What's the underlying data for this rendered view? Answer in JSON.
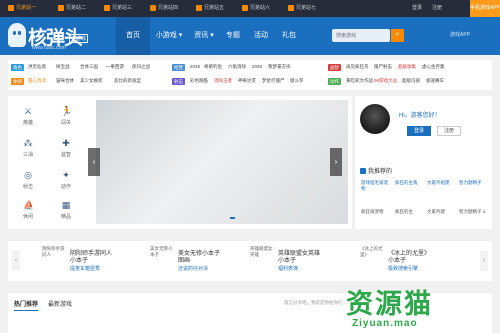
{
  "topbar": {
    "tabs": [
      "兄弟站一",
      "兄弟站二",
      "兄弟站三",
      "兄弟站四",
      "兄弟站五",
      "兄弟站六",
      "兄弟站七"
    ],
    "login": "登录",
    "register": "注册",
    "app": "手机游戏APP"
  },
  "logo": {
    "title": "核弹头",
    "tag": "小游戏",
    "url": "www.h5uc.com"
  },
  "nav": {
    "items": [
      "首页",
      "小游戏 ▾",
      "资讯 ▾",
      "专题",
      "活动",
      "礼包"
    ],
    "search_placeholder": "搜索游戏",
    "mobile": "游戏APP"
  },
  "categories": {
    "row1": [
      {
        "badge": "角色",
        "color": "#2b9bd8",
        "items": [
          "洪荒仙境",
          "探宝战",
          "合体三国",
          "一拳西游",
          "侠归之战"
        ]
      },
      {
        "badge": "经营",
        "color": "#4a8fd6",
        "items": [
          "2048",
          "奇葩钓鱼",
          "六角消除",
          "2048",
          "我梦豪方块"
        ]
      },
      {
        "badge": "益智",
        "color": "#d53c3c",
        "items": [
          "再见疯狂鸟",
          "僵尸射击",
          "超级收集",
          "虚心生存集"
        ]
      }
    ],
    "row2": [
      {
        "badge": "休闲",
        "color": "#f08a1a",
        "items": [
          "甜心消消",
          "猫咪合体",
          "美少女换装",
          "恶比的新发型"
        ]
      },
      {
        "badge": "射击",
        "color": "#6a5acd",
        "items": [
          "彩色跑酷",
          "消除王者",
          "神奇达芙",
          "梦星打僵尸",
          "傲斗罗"
        ]
      },
      {
        "badge": "动作",
        "color": "#4caf50",
        "items": [
          "黄吃蛇大作战",
          "90游戏大战",
          "超级玛丽",
          "极速赛车"
        ]
      }
    ]
  },
  "genres": [
    "英雄",
    "闯关",
    "三消",
    "益智",
    "射击",
    "动作",
    "休闲",
    "精品"
  ],
  "user": {
    "greeting": "Hi，游客您好！",
    "login": "登录",
    "register": "注册",
    "rec_title": "我推荐的",
    "recs": [
      {
        "alt": "游戏怪毛骑宠物",
        "name": "疯狂骑宠物"
      },
      {
        "alt": "疯狂的主角",
        "name": "疯狂的主"
      },
      {
        "alt": "大家齐组建",
        "name": "大家齐建"
      },
      {
        "alt": "智力题精子",
        "name": "智力题精子 4"
      }
    ]
  },
  "strip": [
    {
      "alt": "阴阳师手游同人",
      "t1": "阴阳师手游同人",
      "t2": "小本子",
      "link": "提茧车箱竖秀"
    },
    {
      "alt": "美女无惨小本子",
      "t1": "美女无修小本子",
      "t2": "图画",
      "link": "还说的仔对决"
    },
    {
      "alt": "英雄联盟女英雄",
      "t1": "英雄联盟女英雄",
      "t2": "小本子",
      "link": "福利表演"
    },
    {
      "alt": "《冰上的尤里》",
      "t1": "《冰上的尤里》",
      "t2": "小本子",
      "link": "极致搜索引擎"
    }
  ],
  "bottom": {
    "tabs": [
      "热门推荐",
      "最新游戏"
    ],
    "hint": "留言分享吧，我欢迎你给你们..."
  },
  "watermark": {
    "cn": "资源猫",
    "en": "Ziyuan.mao"
  }
}
